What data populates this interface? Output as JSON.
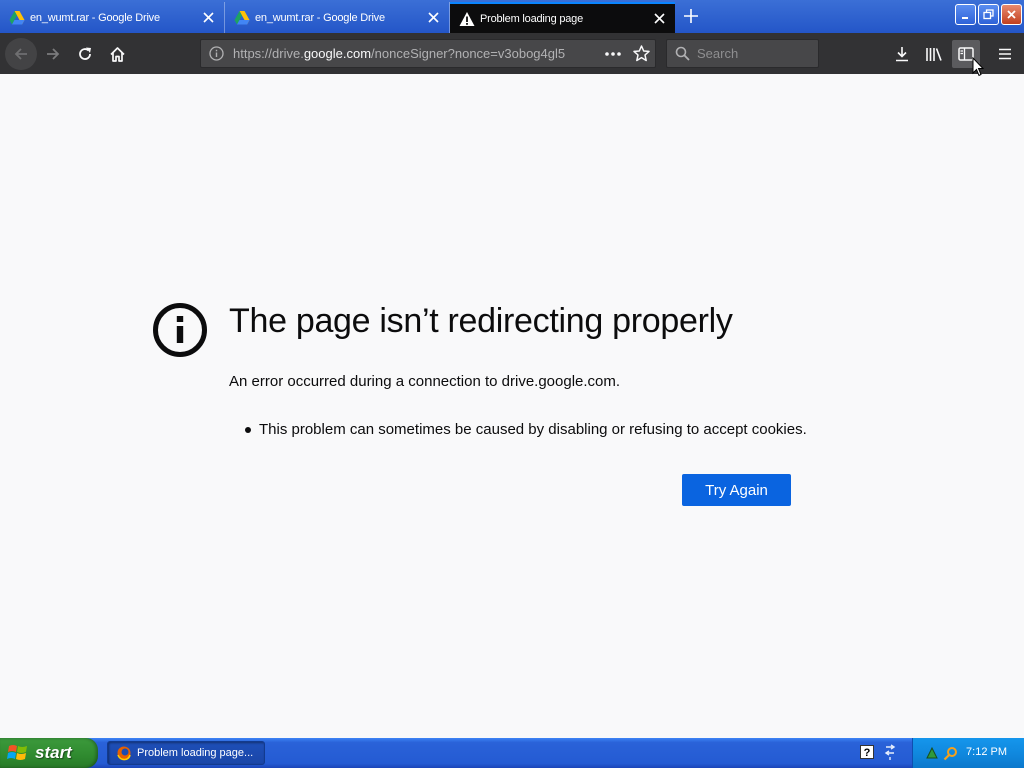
{
  "tabs": [
    {
      "title": "en_wumt.rar - Google Drive",
      "icon": "google-drive-icon",
      "active": false
    },
    {
      "title": "en_wumt.rar - Google Drive",
      "icon": "google-drive-icon",
      "active": false
    },
    {
      "title": "Problem loading page",
      "icon": "warning-icon",
      "active": true
    }
  ],
  "urlbar": {
    "prefix": "https://drive.",
    "host": "google.com",
    "path": "/nonceSigner?nonce=v3obog4gl5"
  },
  "search": {
    "placeholder": "Search"
  },
  "error": {
    "title": "The page isn’t redirecting properly",
    "description": "An error occurred during a connection to drive.google.com.",
    "hint": "This problem can sometimes be caused by disabling or refusing to accept cookies.",
    "button": "Try Again"
  },
  "taskbar": {
    "start_label": "start",
    "task_label": "Problem loading page...",
    "clock": "7:12 PM"
  },
  "colors": {
    "accent": "#0a84ff",
    "button": "#0a64e0",
    "toolbar": "#323234",
    "page_bg": "#f9f9fa"
  }
}
